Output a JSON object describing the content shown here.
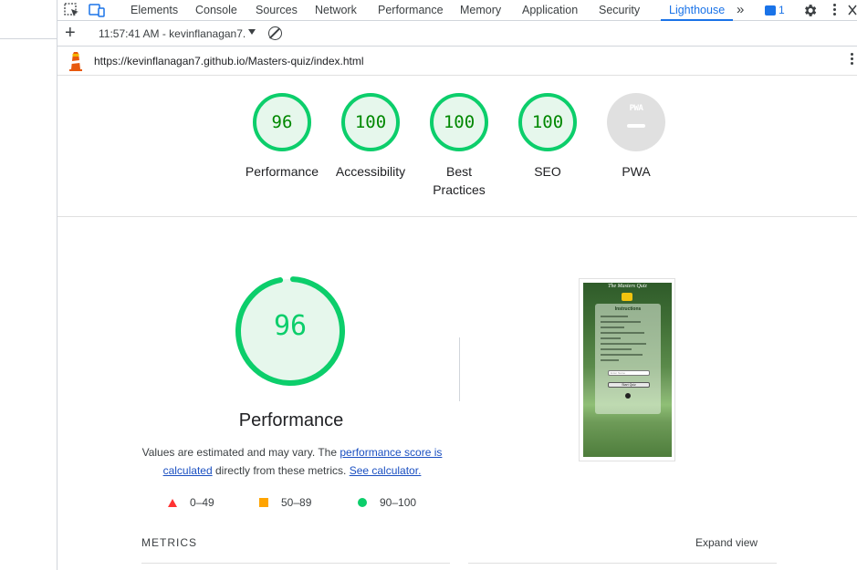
{
  "devtools": {
    "tabs": [
      "Elements",
      "Console",
      "Sources",
      "Network",
      "Performance",
      "Memory",
      "Application",
      "Security",
      "Lighthouse"
    ],
    "active_tab": "Lighthouse",
    "more_tabs": "»",
    "issues_count": "1"
  },
  "toolbar": {
    "report_selector": "11:57:41 AM - kevinflanagan7."
  },
  "report": {
    "url": "https://kevinflanagan7.github.io/Masters-quiz/index.html",
    "categories": [
      {
        "score": "96",
        "label": "Performance"
      },
      {
        "score": "100",
        "label": "Accessibility"
      },
      {
        "score": "100",
        "label": "Best Practices"
      },
      {
        "score": "100",
        "label": "SEO"
      },
      {
        "score": "",
        "label": "PWA"
      }
    ],
    "pwa_badge_text": "PWA",
    "main": {
      "score": "96",
      "score_fraction": 0.96,
      "title": "Performance",
      "desc_prefix": "Values are estimated and may vary. The ",
      "desc_link1": "performance score is calculated",
      "desc_middle": " directly from these metrics. ",
      "desc_link2": "See calculator."
    },
    "legend": [
      {
        "label": "0–49",
        "color": "#ff3333"
      },
      {
        "label": "50–89",
        "color": "#ffa400"
      },
      {
        "label": "90–100",
        "color": "#0cce6b"
      }
    ],
    "metrics_label": "METRICS",
    "expand_label": "Expand view"
  },
  "thumbnail": {
    "title": "The Masters Quiz",
    "heading": "Instructions",
    "input_placeholder": "Enter Name",
    "button": "Start Quiz"
  },
  "colors": {
    "pass": "#0cce6b",
    "pass_bg": "#e6f7ec",
    "accent": "#1a73e8"
  }
}
